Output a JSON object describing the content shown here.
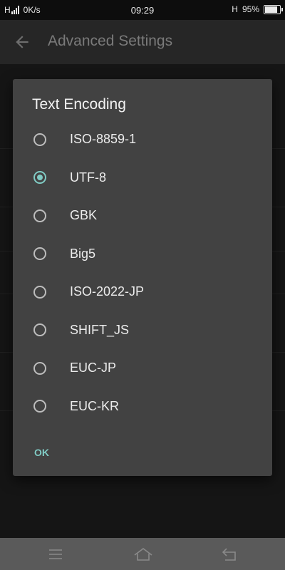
{
  "status_bar": {
    "network_type": "H",
    "net_speed": "0K/s",
    "time": "09:29",
    "data_type": "H",
    "battery": "95%",
    "battery_level": 0.95
  },
  "app_bar": {
    "title": "Advanced Settings",
    "back_icon": "arrow-left-icon"
  },
  "dialog": {
    "title": "Text Encoding",
    "options": [
      {
        "label": "ISO-8859-1",
        "selected": false
      },
      {
        "label": "UTF-8",
        "selected": true
      },
      {
        "label": "GBK",
        "selected": false
      },
      {
        "label": "Big5",
        "selected": false
      },
      {
        "label": "ISO-2022-JP",
        "selected": false
      },
      {
        "label": "SHIFT_JS",
        "selected": false
      },
      {
        "label": "EUC-JP",
        "selected": false
      },
      {
        "label": "EUC-KR",
        "selected": false
      }
    ],
    "ok_label": "OK",
    "accent_color": "#80cbc4"
  },
  "nav_bar": {
    "icons": [
      "menu-icon",
      "home-icon",
      "back-icon"
    ]
  }
}
